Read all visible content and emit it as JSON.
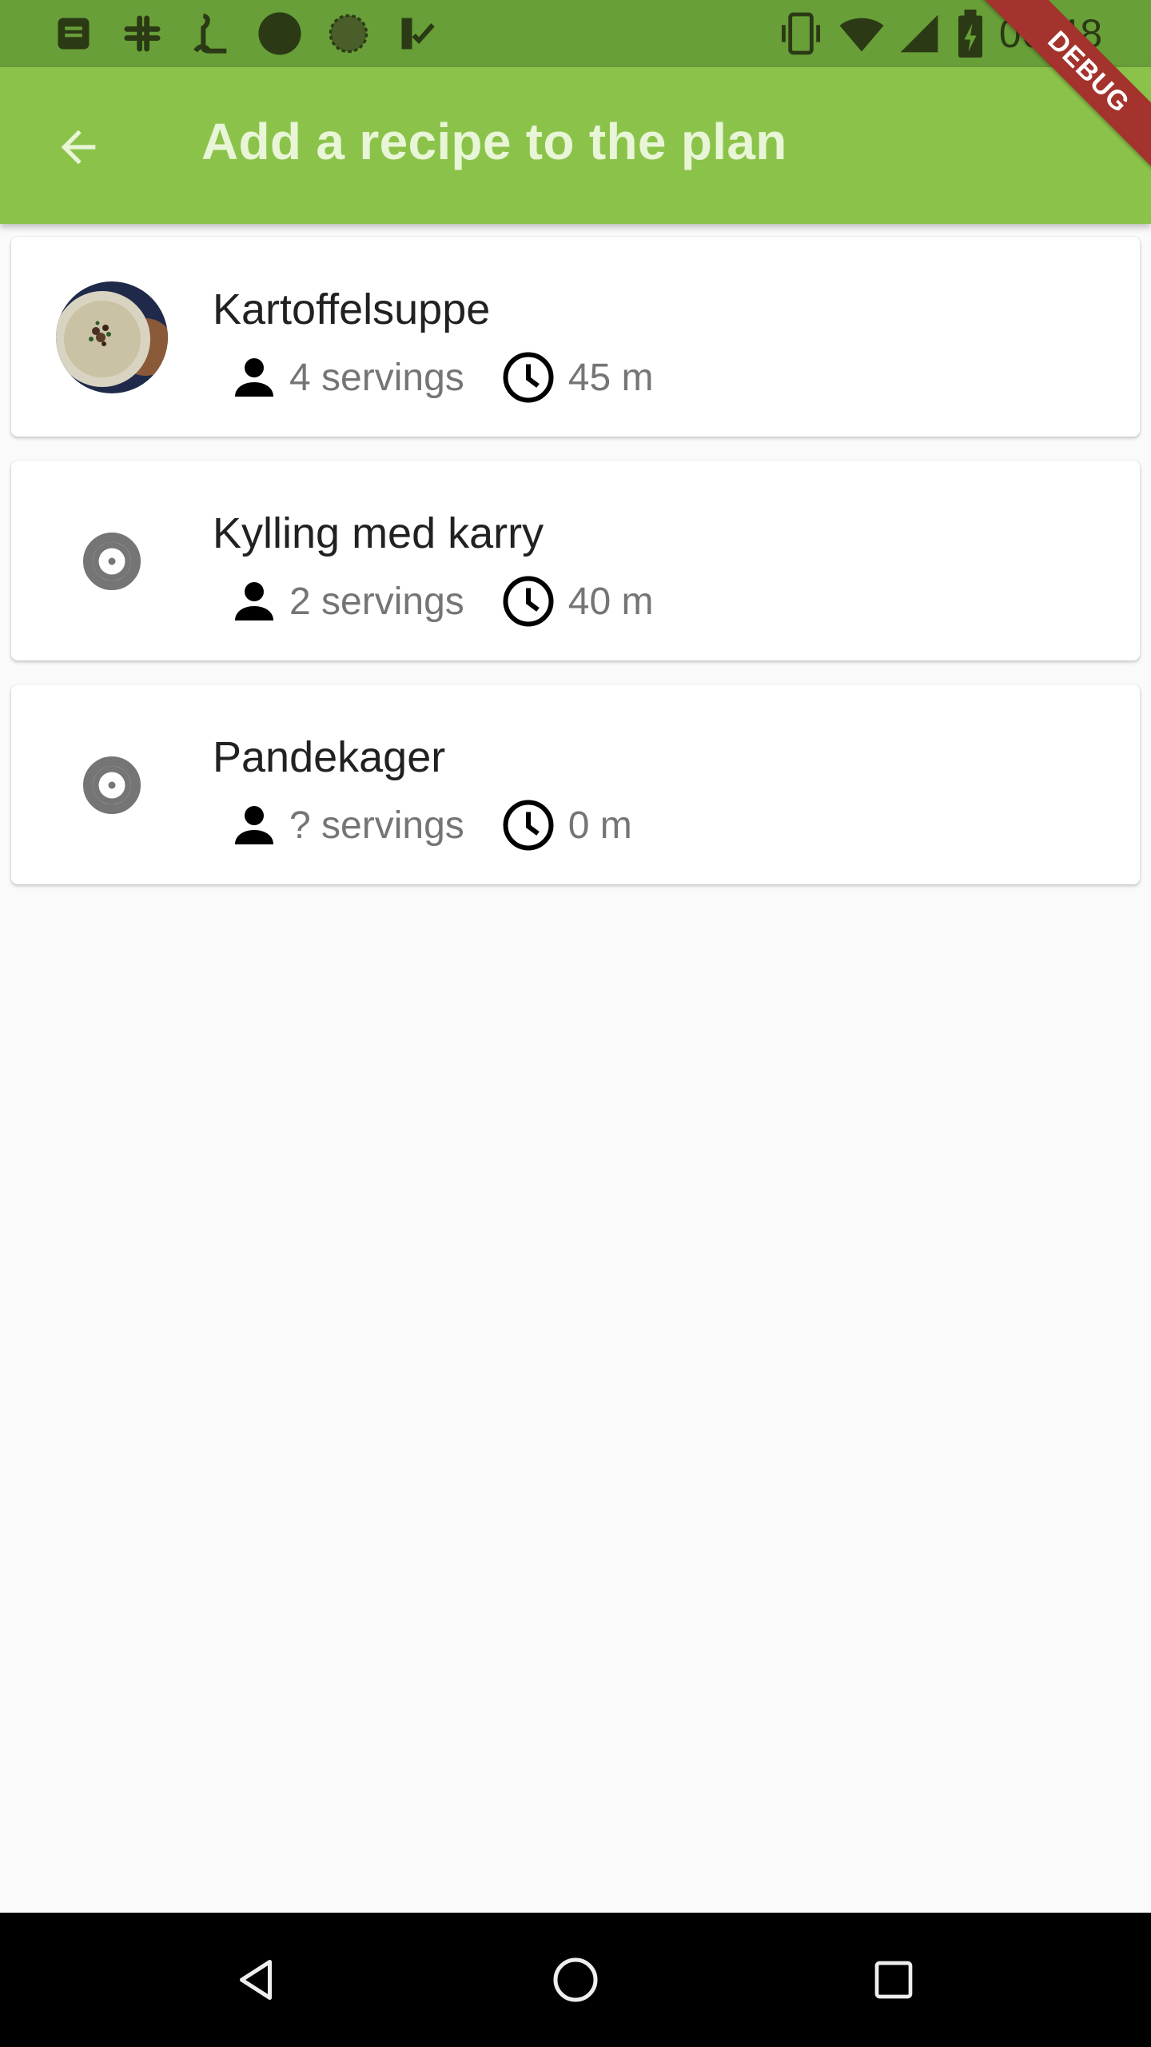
{
  "status_bar": {
    "time": "00:48",
    "left_icons": [
      "notes-icon",
      "slack-icon",
      "app-icon",
      "record-icon",
      "sync-icon",
      "tasks-icon"
    ],
    "right_icons": [
      "vibrate-icon",
      "wifi-icon",
      "signal-icon",
      "battery-icon"
    ]
  },
  "app_bar": {
    "title": "Add a recipe to the plan",
    "back_icon": "arrow-back-icon",
    "color": "#8bc34a"
  },
  "debug_banner": "DEBUG",
  "recipes": [
    {
      "name": "Kartoffelsuppe",
      "servings": "4 servings",
      "time": "45 m",
      "image": "soup-photo"
    },
    {
      "name": "Kylling med karry",
      "servings": "2 servings",
      "time": "40 m",
      "image": "placeholder-icon"
    },
    {
      "name": "Pandekager",
      "servings": "? servings",
      "time": "0 m",
      "image": "placeholder-icon"
    }
  ],
  "nav_bar": {
    "buttons": [
      "back-triangle-icon",
      "home-circle-icon",
      "recents-square-icon"
    ]
  }
}
